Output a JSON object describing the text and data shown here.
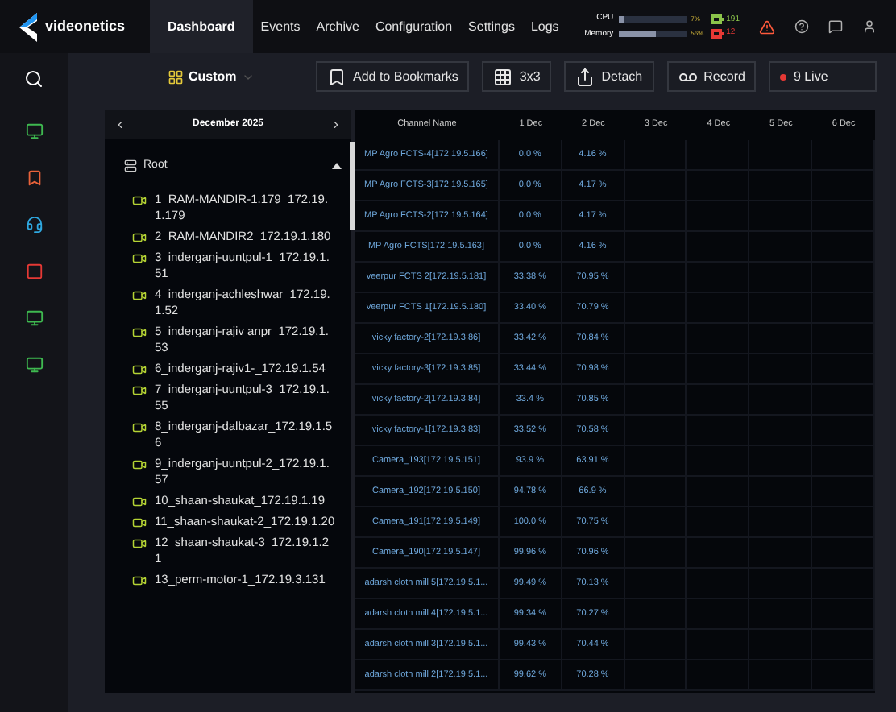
{
  "header": {
    "logo_text": "videonetics",
    "nav": [
      {
        "label": "Dashboard",
        "selected": true
      },
      {
        "label": "Events",
        "selected": false
      },
      {
        "label": "Archive",
        "selected": false
      },
      {
        "label": "Configuration",
        "selected": false
      },
      {
        "label": "Settings",
        "selected": false
      },
      {
        "label": "Logs",
        "selected": false
      }
    ],
    "meters": [
      {
        "label": "CPU",
        "level": 0.07,
        "reading": "7%"
      },
      {
        "label": "Memory",
        "level": 0.56,
        "reading": "56%"
      }
    ],
    "counts": [
      {
        "value": "191",
        "color": "#8bc34a"
      },
      {
        "value": "12",
        "color": "#e53935"
      }
    ]
  },
  "toolbar": {
    "layout": "Custom",
    "buttons": [
      {
        "kind": "bookmark",
        "label": "Add to Bookmarks"
      },
      {
        "kind": "grid",
        "label": "3x3"
      },
      {
        "kind": "detach",
        "label": "Detach"
      },
      {
        "kind": "record",
        "label": "Record"
      },
      {
        "kind": "live",
        "label": "9 Live"
      }
    ]
  },
  "calendar": {
    "month": "December 2025"
  },
  "tree": {
    "label": "Root",
    "expanded": true,
    "children": [
      {
        "label": "1_RAM-MANDIR-1.179_172.19.1.179"
      },
      {
        "label": "2_RAM-MANDIR2_172.19.1.180"
      },
      {
        "label": "3_inderganj-uuntpul-1_172.19.1.51"
      },
      {
        "label": "4_inderganj-achleshwar_172.19.1.52"
      },
      {
        "label": "5_inderganj-rajiv anpr_172.19.1.53"
      },
      {
        "label": "6_inderganj-rajiv1-_172.19.1.54"
      },
      {
        "label": "7_inderganj-uuntpul-3_172.19.1.55"
      },
      {
        "label": "8_inderganj-dalbazar_172.19.1.56"
      },
      {
        "label": "9_inderganj-uuntpul-2_172.19.1.57"
      },
      {
        "label": "10_shaan-shaukat_172.19.1.19"
      },
      {
        "label": "11_shaan-shaukat-2_172.19.1.20"
      },
      {
        "label": "12_shaan-shaukat-3_172.19.1.21"
      },
      {
        "label": "13_perm-motor-1_172.19.3.131"
      }
    ]
  },
  "table": {
    "columns": [
      "Channel Name",
      "1 Dec",
      "2 Dec",
      "3 Dec",
      "4 Dec",
      "5 Dec",
      "6 Dec"
    ],
    "rows": [
      [
        "MP Agro FCTS-4[172.19.5.166]",
        "0.0 %",
        "4.16 %"
      ],
      [
        "MP Agro FCTS-3[172.19.5.165]",
        "0.0 %",
        "4.17 %"
      ],
      [
        "MP Agro FCTS-2[172.19.5.164]",
        "0.0 %",
        "4.17 %"
      ],
      [
        "MP Agro FCTS[172.19.5.163]",
        "0.0 %",
        "4.16 %"
      ],
      [
        "veerpur FCTS 2[172.19.5.181]",
        "33.38 %",
        "70.95 %"
      ],
      [
        "veerpur FCTS 1[172.19.5.180]",
        "33.40 %",
        "70.79 %"
      ],
      [
        "vicky factory-2[172.19.3.86]",
        "33.42 %",
        "70.84 %"
      ],
      [
        "vicky factory-3[172.19.3.85]",
        "33.44 %",
        "70.98 %"
      ],
      [
        "vicky factory-2[172.19.3.84]",
        "33.4 %",
        "70.85 %"
      ],
      [
        "vicky factory-1[172.19.3.83]",
        "33.52 %",
        "70.58 %"
      ],
      [
        "Camera_193[172.19.5.151]",
        "93.9 %",
        "63.91 %"
      ],
      [
        "Camera_192[172.19.5.150]",
        "94.78 %",
        "66.9 %"
      ],
      [
        "Camera_191[172.19.5.149]",
        "100.0 %",
        "70.75 %"
      ],
      [
        "Camera_190[172.19.5.147]",
        "99.96 %",
        "70.96 %"
      ],
      [
        "adarsh cloth mill 5[172.19.5.1...",
        "99.49 %",
        "70.13 %"
      ],
      [
        "adarsh cloth mill 4[172.19.5.1...",
        "99.34 %",
        "70.27 %"
      ],
      [
        "adarsh cloth mill 3[172.19.5.1...",
        "99.43 %",
        "70.44 %"
      ],
      [
        "adarsh cloth mill 2[172.19.5.1...",
        "99.62 %",
        "70.28 %"
      ]
    ]
  }
}
